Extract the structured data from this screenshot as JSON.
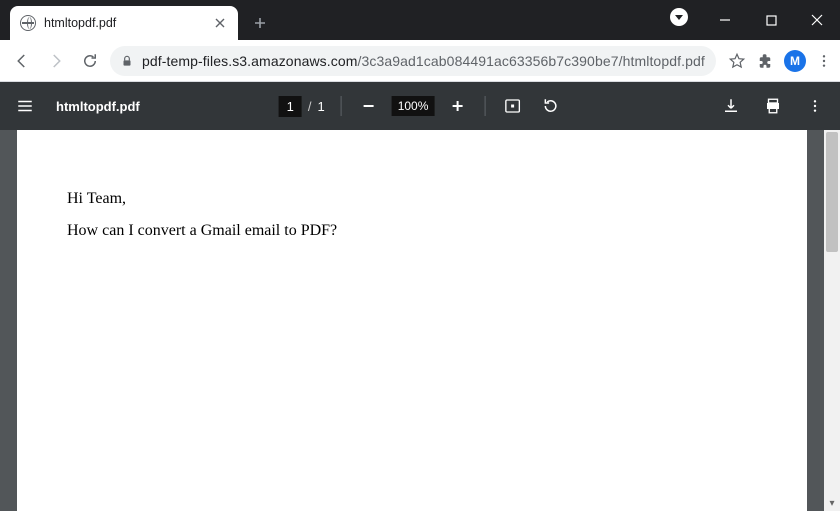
{
  "browser": {
    "tab_title": "htmltopdf.pdf",
    "url_host": "pdf-temp-files.s3.amazonaws.com",
    "url_path": "/3c3a9ad1cab084491ac63356b7c390be7/htmltopdf.pdf",
    "avatar_initial": "M"
  },
  "pdf": {
    "filename": "htmltopdf.pdf",
    "current_page": "1",
    "page_sep": "/",
    "total_pages": "1",
    "zoom": "100%"
  },
  "document": {
    "line1": "Hi Team,",
    "line2": "How can I convert a Gmail email to PDF?"
  }
}
